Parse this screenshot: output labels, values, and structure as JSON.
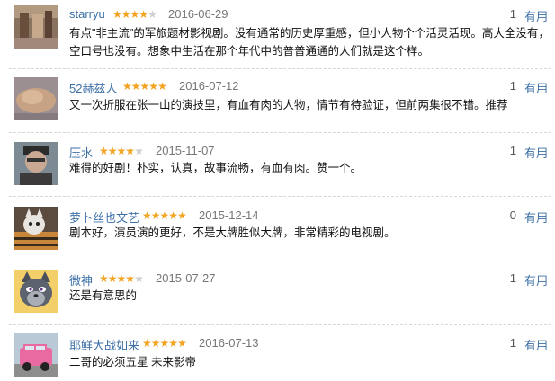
{
  "colors": {
    "link": "#3b6fa6",
    "star_full": "#f2a31f",
    "star_empty": "#cfcfcf",
    "date": "#777777",
    "text": "#111111"
  },
  "useful_label": "有用",
  "comments": [
    {
      "user": "starryu",
      "stars": 4,
      "date": "2016-06-29",
      "votes": "1",
      "text": "有点\"非主流\"的军旅题材影视剧。没有通常的历史厚重感，但小人物个个活灵活现。高大全没有，空口号也没有。想象中生活在那个年代中的普普通通的人们就是这个样。",
      "avatar": "abstract-photo-avatar"
    },
    {
      "user": "52赫兹人",
      "stars": 5,
      "date": "2016-07-12",
      "votes": "1",
      "text": "又一次折服在张一山的演技里，有血有肉的人物，情节有待验证，但前两集很不错。推荐",
      "avatar": "blurry-photo-avatar"
    },
    {
      "user": "压水",
      "stars": 4,
      "date": "2015-11-07",
      "votes": "1",
      "text": "难得的好剧！朴实，认真，故事流畅，有血有肉。赞一个。",
      "avatar": "man-portrait-avatar"
    },
    {
      "user": "萝卜丝也文艺",
      "stars": 5,
      "date": "2015-12-14",
      "votes": "0",
      "text": "剧本好，演员演的更好，不是大牌胜似大牌，非常精彩的电视剧。",
      "avatar": "cat-photo-avatar"
    },
    {
      "user": "微神",
      "stars": 4,
      "date": "2015-07-27",
      "votes": "1",
      "text": "还是有意思的",
      "avatar": "cartoon-wolf-avatar"
    },
    {
      "user": "耶鲜大战如来",
      "stars": 5,
      "date": "2016-07-13",
      "votes": "1",
      "text": "二哥的必须五星 未来影帝",
      "avatar": "pink-car-avatar"
    }
  ]
}
